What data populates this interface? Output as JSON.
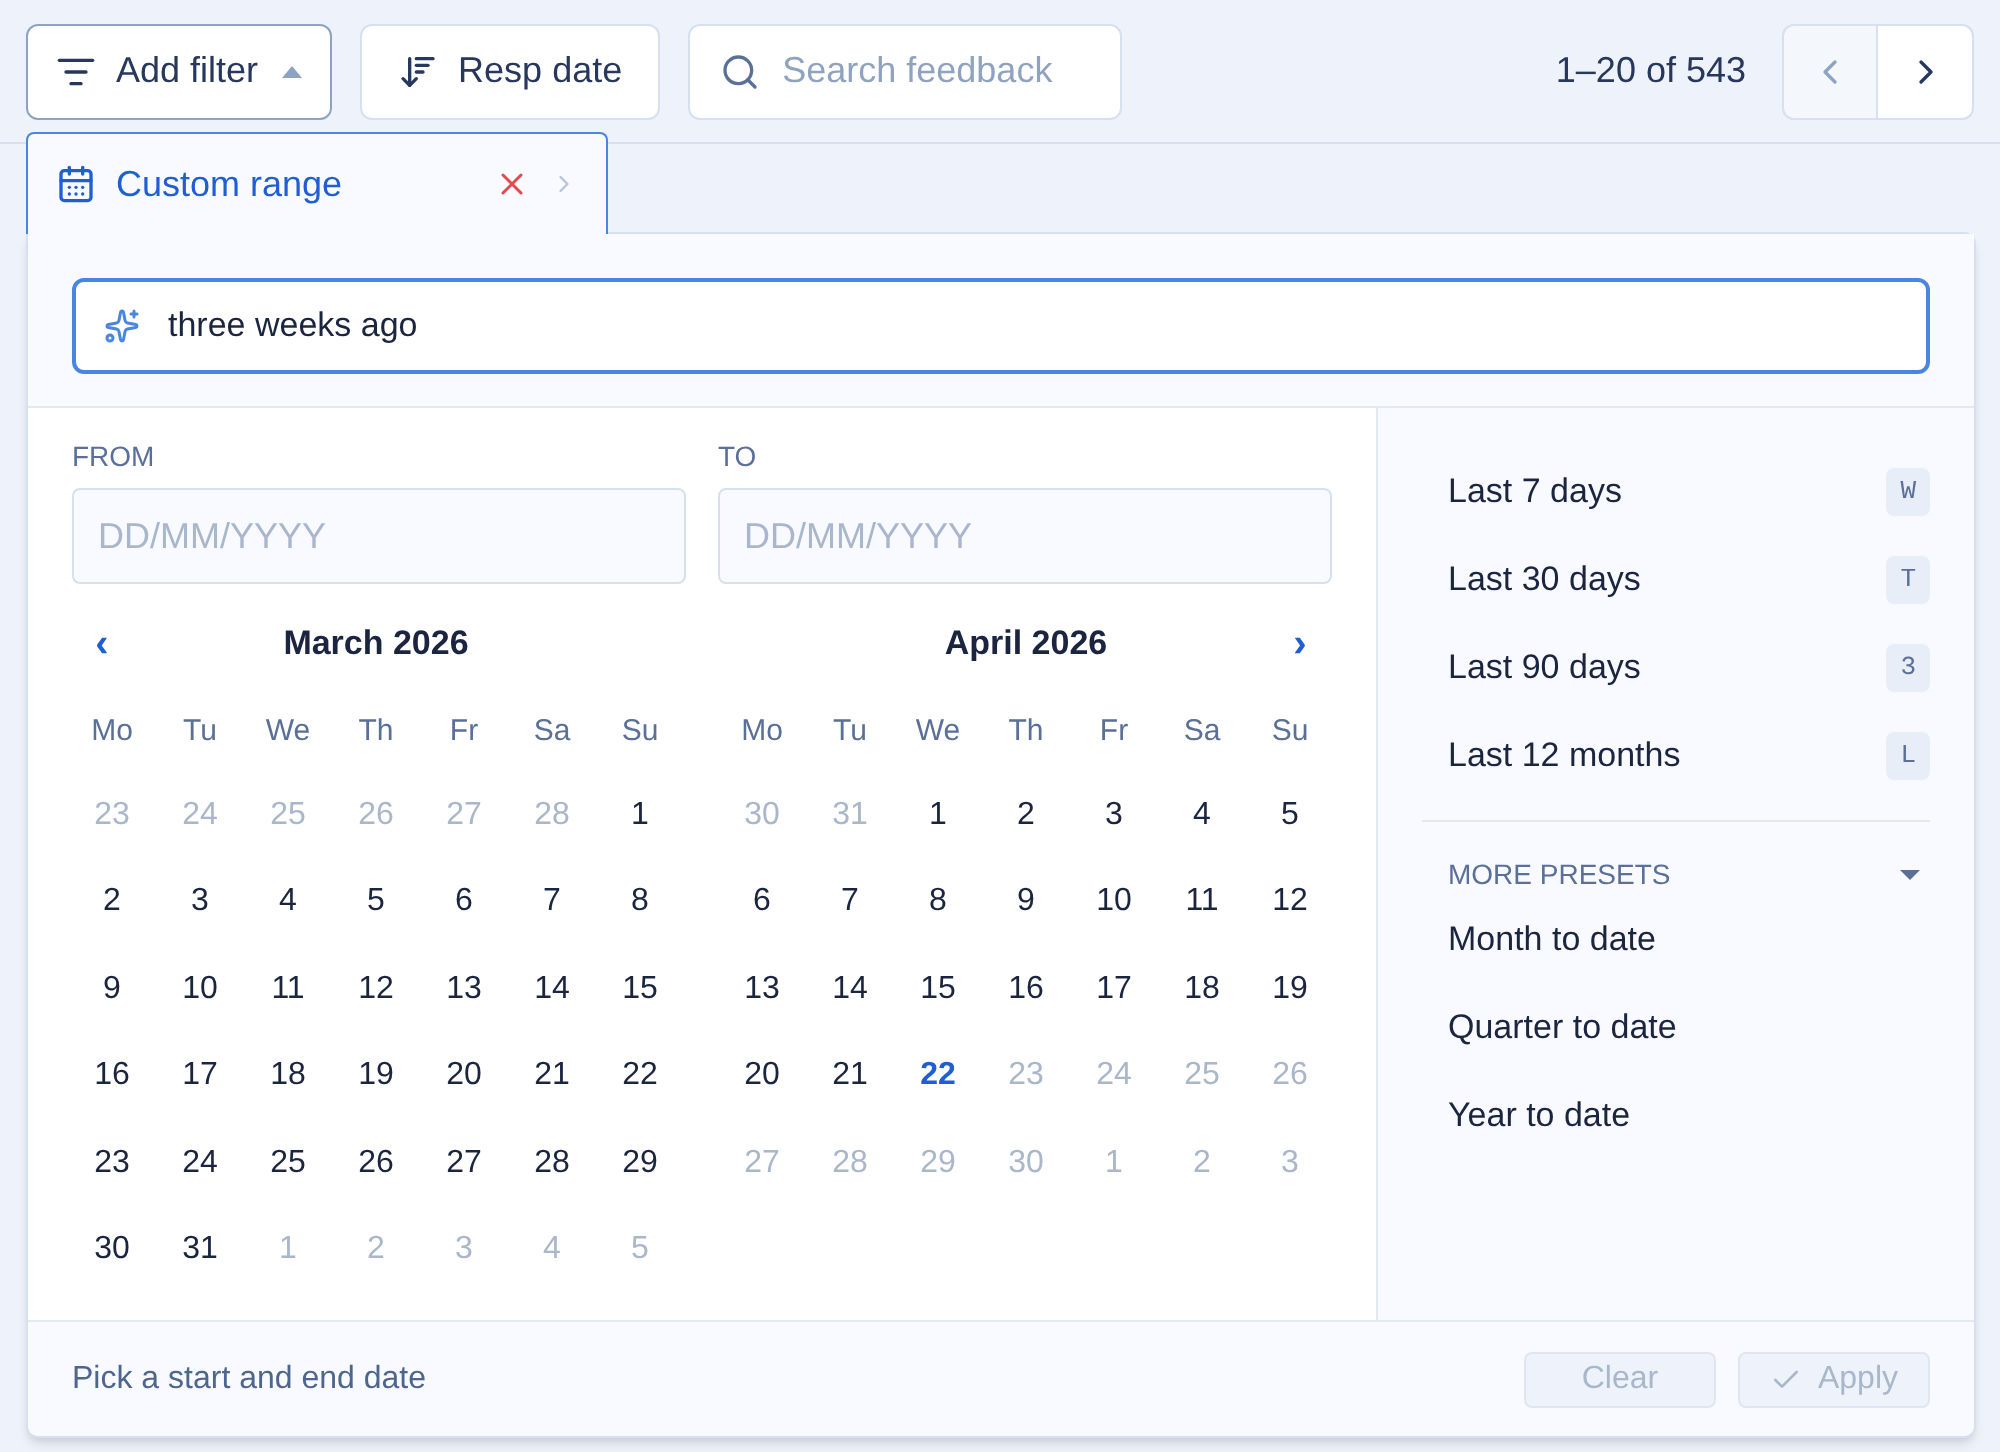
{
  "toolbar": {
    "filter_button": "Add filter",
    "sort_button": "Resp date",
    "search": {
      "placeholder": "Search feedback"
    },
    "pagination": "1–20 of 543"
  },
  "filter_chip": {
    "label": "Custom range",
    "selected": true
  },
  "smart_input": {
    "value": "three weeks ago"
  },
  "from": {
    "label": "FROM",
    "placeholder": "DD/MM/YYYY"
  },
  "to": {
    "label": "TO",
    "placeholder": "DD/MM/YYYY"
  },
  "months": [
    {
      "title": "March 2026",
      "nav": "‹",
      "weekdays": [
        "Mo",
        "Tu",
        "We",
        "Th",
        "Fr",
        "Sa",
        "Su"
      ],
      "weeks": [
        [
          {
            "d": "23",
            "kind": "outside"
          },
          {
            "d": "24",
            "kind": "outside"
          },
          {
            "d": "25",
            "kind": "outside"
          },
          {
            "d": "26",
            "kind": "outside"
          },
          {
            "d": "27",
            "kind": "outside"
          },
          {
            "d": "28",
            "kind": "outside"
          },
          {
            "d": "1",
            "kind": "normal"
          }
        ],
        [
          {
            "d": "2",
            "kind": "normal"
          },
          {
            "d": "3",
            "kind": "normal"
          },
          {
            "d": "4",
            "kind": "normal"
          },
          {
            "d": "5",
            "kind": "normal"
          },
          {
            "d": "6",
            "kind": "normal"
          },
          {
            "d": "7",
            "kind": "normal"
          },
          {
            "d": "8",
            "kind": "normal"
          }
        ],
        [
          {
            "d": "9",
            "kind": "normal"
          },
          {
            "d": "10",
            "kind": "normal"
          },
          {
            "d": "11",
            "kind": "normal"
          },
          {
            "d": "12",
            "kind": "normal"
          },
          {
            "d": "13",
            "kind": "normal"
          },
          {
            "d": "14",
            "kind": "normal"
          },
          {
            "d": "15",
            "kind": "normal"
          }
        ],
        [
          {
            "d": "16",
            "kind": "normal"
          },
          {
            "d": "17",
            "kind": "normal"
          },
          {
            "d": "18",
            "kind": "normal"
          },
          {
            "d": "19",
            "kind": "normal"
          },
          {
            "d": "20",
            "kind": "normal"
          },
          {
            "d": "21",
            "kind": "normal"
          },
          {
            "d": "22",
            "kind": "normal"
          }
        ],
        [
          {
            "d": "23",
            "kind": "normal"
          },
          {
            "d": "24",
            "kind": "normal"
          },
          {
            "d": "25",
            "kind": "normal"
          },
          {
            "d": "26",
            "kind": "normal"
          },
          {
            "d": "27",
            "kind": "normal"
          },
          {
            "d": "28",
            "kind": "normal"
          },
          {
            "d": "29",
            "kind": "normal"
          }
        ],
        [
          {
            "d": "30",
            "kind": "normal"
          },
          {
            "d": "31",
            "kind": "normal"
          },
          {
            "d": "1",
            "kind": "outside"
          },
          {
            "d": "2",
            "kind": "outside"
          },
          {
            "d": "3",
            "kind": "outside"
          },
          {
            "d": "4",
            "kind": "outside"
          },
          {
            "d": "5",
            "kind": "outside"
          }
        ]
      ]
    },
    {
      "title": "April 2026",
      "nav": "›",
      "weekdays": [
        "Mo",
        "Tu",
        "We",
        "Th",
        "Fr",
        "Sa",
        "Su"
      ],
      "weeks": [
        [
          {
            "d": "30",
            "kind": "outside"
          },
          {
            "d": "31",
            "kind": "outside"
          },
          {
            "d": "1",
            "kind": "normal"
          },
          {
            "d": "2",
            "kind": "normal"
          },
          {
            "d": "3",
            "kind": "normal"
          },
          {
            "d": "4",
            "kind": "normal"
          },
          {
            "d": "5",
            "kind": "normal"
          }
        ],
        [
          {
            "d": "6",
            "kind": "normal"
          },
          {
            "d": "7",
            "kind": "normal"
          },
          {
            "d": "8",
            "kind": "normal"
          },
          {
            "d": "9",
            "kind": "normal"
          },
          {
            "d": "10",
            "kind": "normal"
          },
          {
            "d": "11",
            "kind": "normal"
          },
          {
            "d": "12",
            "kind": "normal"
          }
        ],
        [
          {
            "d": "13",
            "kind": "normal"
          },
          {
            "d": "14",
            "kind": "normal"
          },
          {
            "d": "15",
            "kind": "normal"
          },
          {
            "d": "16",
            "kind": "normal"
          },
          {
            "d": "17",
            "kind": "normal"
          },
          {
            "d": "18",
            "kind": "normal"
          },
          {
            "d": "19",
            "kind": "normal"
          }
        ],
        [
          {
            "d": "20",
            "kind": "normal"
          },
          {
            "d": "21",
            "kind": "normal"
          },
          {
            "d": "22",
            "kind": "today"
          },
          {
            "d": "23",
            "kind": "disabled"
          },
          {
            "d": "24",
            "kind": "disabled"
          },
          {
            "d": "25",
            "kind": "disabled"
          },
          {
            "d": "26",
            "kind": "disabled"
          }
        ],
        [
          {
            "d": "27",
            "kind": "disabled"
          },
          {
            "d": "28",
            "kind": "disabled"
          },
          {
            "d": "29",
            "kind": "disabled"
          },
          {
            "d": "30",
            "kind": "disabled"
          },
          {
            "d": "1",
            "kind": "outside"
          },
          {
            "d": "2",
            "kind": "outside"
          },
          {
            "d": "3",
            "kind": "outside"
          }
        ]
      ]
    }
  ],
  "presets": [
    {
      "label": "Last 7 days",
      "key": "W"
    },
    {
      "label": "Last 30 days",
      "key": "T"
    },
    {
      "label": "Last 90 days",
      "key": "3"
    },
    {
      "label": "Last 12 months",
      "key": "L"
    }
  ],
  "more_presets": {
    "title": "MORE PRESETS",
    "expanded": true,
    "items": [
      "Month to date",
      "Quarter to date",
      "Year to date"
    ]
  },
  "footer": {
    "hint": "Pick a start and end date",
    "buttons": [
      {
        "label": "Clear",
        "disabled": true
      },
      {
        "label": "Apply",
        "disabled": true
      }
    ]
  }
}
